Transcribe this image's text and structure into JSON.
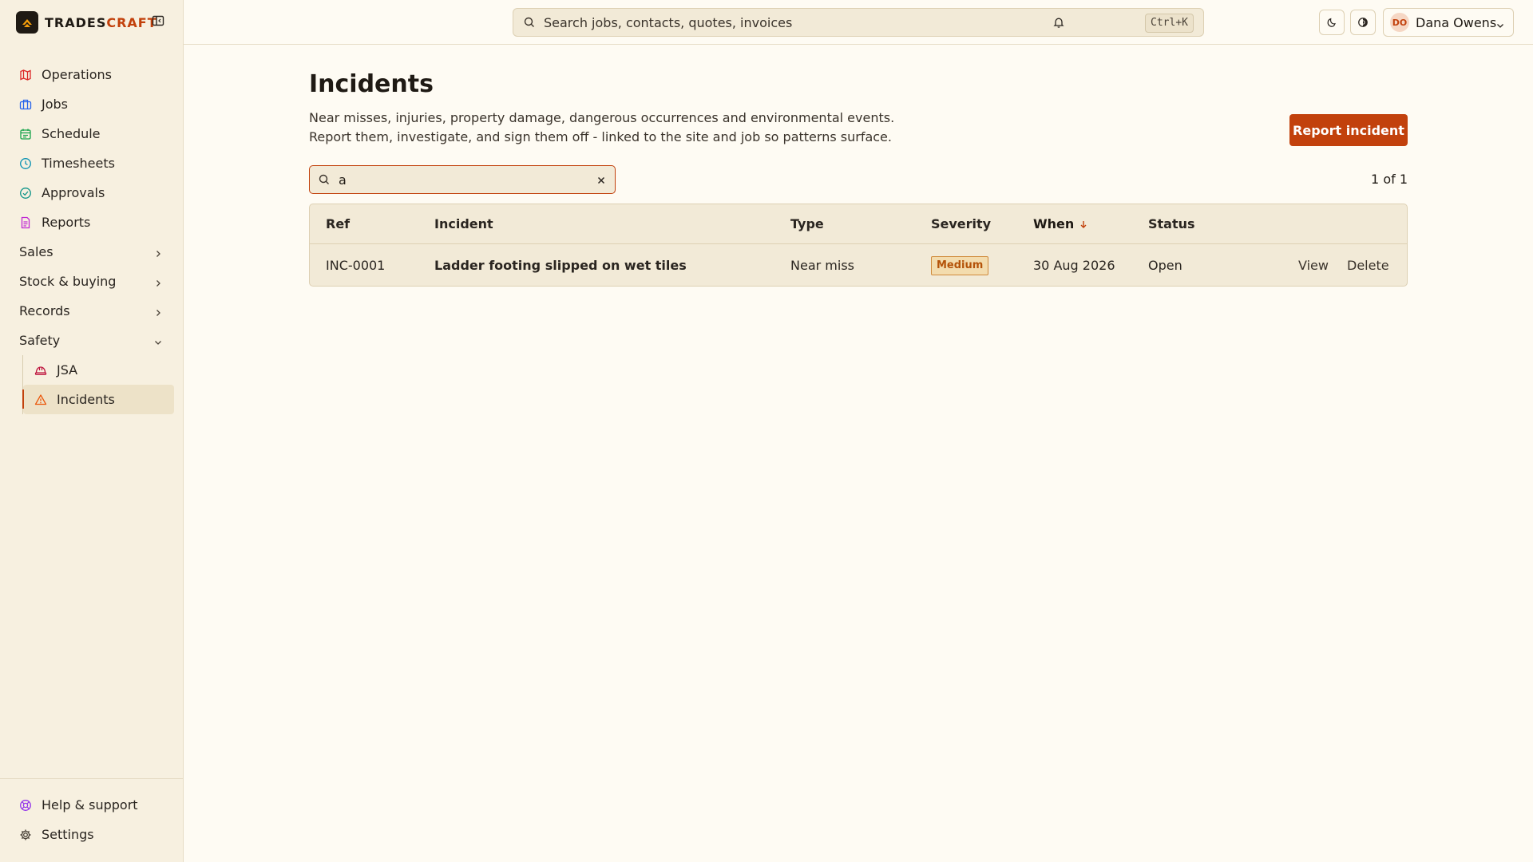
{
  "brand": {
    "name_part1": "TRADES",
    "name_part2": "CRAFT"
  },
  "sidebar": {
    "items": [
      {
        "label": "Operations",
        "icon": "map-icon",
        "color": "#dc2626"
      },
      {
        "label": "Jobs",
        "icon": "briefcase-icon",
        "color": "#2563eb"
      },
      {
        "label": "Schedule",
        "icon": "calendar-icon",
        "color": "#16a34a"
      },
      {
        "label": "Timesheets",
        "icon": "clock-icon",
        "color": "#0891b2"
      },
      {
        "label": "Approvals",
        "icon": "check-circle-icon",
        "color": "#0d9488"
      },
      {
        "label": "Reports",
        "icon": "document-icon",
        "color": "#c026d3"
      }
    ],
    "groups": [
      {
        "label": "Sales",
        "expanded": false
      },
      {
        "label": "Stock & buying",
        "expanded": false
      },
      {
        "label": "Records",
        "expanded": false
      },
      {
        "label": "Safety",
        "expanded": true
      }
    ],
    "safety_items": [
      {
        "label": "JSA",
        "icon": "hard-hat-icon"
      },
      {
        "label": "Incidents",
        "icon": "warning-triangle-icon",
        "active": true
      }
    ],
    "bottom": [
      {
        "label": "Help & support",
        "icon": "lifebuoy-icon"
      },
      {
        "label": "Settings",
        "icon": "gear-icon"
      }
    ]
  },
  "topbar": {
    "search_placeholder": "Search jobs, contacts, quotes, invoices",
    "shortcut": "Ctrl+K",
    "user": {
      "initials": "DO",
      "name": "Dana Owens"
    }
  },
  "page": {
    "title": "Incidents",
    "description_line1": "Near misses, injuries, property damage, dangerous occurrences and environmental events.",
    "description_line2": "Report them, investigate, and sign them off - linked to the site and job so patterns surface.",
    "report_button": "Report incident",
    "filter_value": "a",
    "count": "1 of 1"
  },
  "table": {
    "columns": {
      "ref": "Ref",
      "incident": "Incident",
      "type": "Type",
      "severity": "Severity",
      "when": "When",
      "status": "Status"
    },
    "sorted_by": "When",
    "rows": [
      {
        "ref": "INC-0001",
        "incident": "Ladder footing slipped on wet tiles",
        "type": "Near miss",
        "severity": "Medium",
        "when": "30 Aug 2026",
        "status": "Open",
        "view": "View",
        "delete": "Delete"
      }
    ]
  },
  "colors": {
    "accent": "#c2410c",
    "background": "#fefbf3",
    "sidebar": "#f7f0e0"
  }
}
